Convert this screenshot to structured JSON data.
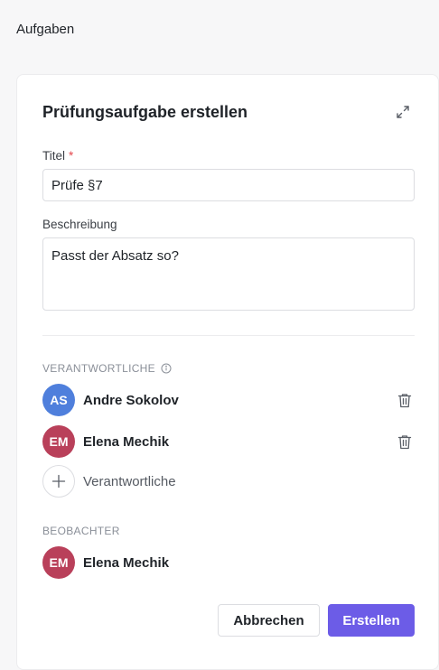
{
  "page": {
    "heading": "Aufgaben"
  },
  "dialog": {
    "title": "Prüfungsaufgabe erstellen",
    "expand_icon": "expand-arrows-icon"
  },
  "form": {
    "title_label": "Titel",
    "title_required_marker": "*",
    "title_value": "Prüfe §7",
    "description_label": "Beschreibung",
    "description_value": "Passt der Absatz so?"
  },
  "assignees": {
    "section_label": "VERANTWORTLICHE",
    "info_icon": "info-icon",
    "people": [
      {
        "initials": "AS",
        "name": "Andre Sokolov",
        "color": "#4f7fdc"
      },
      {
        "initials": "EM",
        "name": "Elena Mechik",
        "color": "#b9405a"
      }
    ],
    "add_label": "Verantwortliche",
    "add_icon": "plus-icon",
    "remove_icon": "trash-icon"
  },
  "observers": {
    "section_label": "BEOBACHTER",
    "people": [
      {
        "initials": "EM",
        "name": "Elena Mechik",
        "color": "#b9405a"
      }
    ]
  },
  "actions": {
    "cancel_label": "Abbrechen",
    "create_label": "Erstellen"
  },
  "colors": {
    "primary": "#6c5ce7",
    "required": "#e5484d"
  }
}
